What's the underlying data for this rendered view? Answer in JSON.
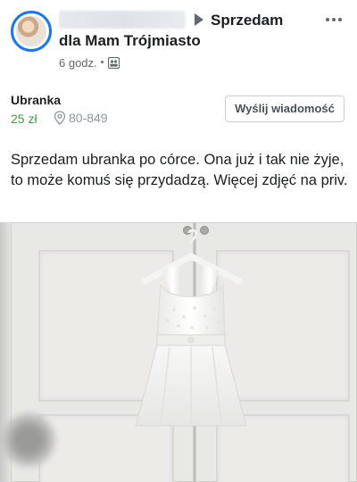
{
  "post": {
    "author_name": "",
    "group_name_line1": "Sprzedam",
    "group_name_line2": "dla Mam Trójmiasto",
    "time": "6 godz.",
    "meta_separator": "•",
    "privacy_icon": "group-icon",
    "more_icon": "more-horizontal-icon"
  },
  "listing": {
    "title": "Ubranka",
    "price": "25 zł",
    "location": "80-849",
    "location_icon": "map-pin-icon",
    "message_button_label": "Wyślij wiadomość"
  },
  "text": "Sprzedam ubranka po córce. Ona już i tak nie żyje, to może komuś się przydadzą. Więcej zdjęć na priv.",
  "colors": {
    "accent": "#1877f2",
    "price": "#42a040",
    "secondary_text": "#65676b"
  }
}
